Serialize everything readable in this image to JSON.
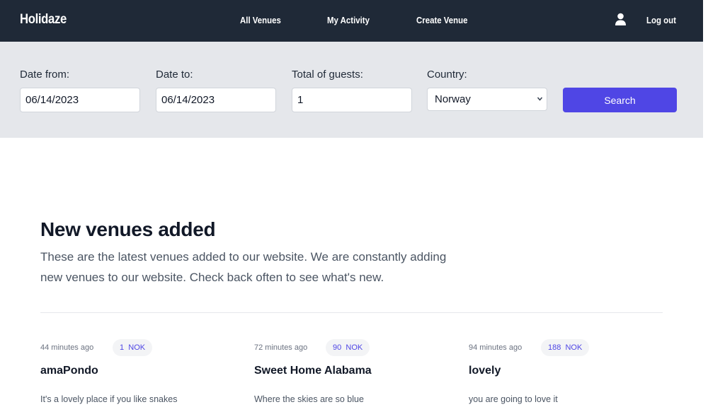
{
  "header": {
    "brand": "Holidaze",
    "nav": {
      "all_venues": "All Venues",
      "my_activity": "My Activity",
      "create_venue": "Create Venue"
    },
    "logout": "Log out",
    "icons": {
      "user": "user-icon"
    }
  },
  "search": {
    "date_from_label": "Date from:",
    "date_from_value": "06/14/2023",
    "date_to_label": "Date to:",
    "date_to_value": "06/14/2023",
    "guests_label": "Total of guests:",
    "guests_value": "1",
    "country_label": "Country:",
    "country_value": "Norway",
    "button": "Search"
  },
  "main": {
    "title": "New venues added",
    "description": "These are the latest venues added to our website. We are constantly adding new venues to our website. Check back often to see what's new."
  },
  "venues": [
    {
      "time": "44 minutes ago",
      "price": "1",
      "currency": "NOK",
      "title": "amaPondo",
      "description": "It's a lovely place if you like snakes"
    },
    {
      "time": "72 minutes ago",
      "price": "90",
      "currency": "NOK",
      "title": "Sweet Home Alabama",
      "description": "Where the skies are so blue"
    },
    {
      "time": "94 minutes ago",
      "price": "188",
      "currency": "NOK",
      "title": "lovely",
      "description": "you are going to love it"
    }
  ],
  "colors": {
    "header_bg": "#1f2937",
    "search_bg": "#e5e7eb",
    "accent": "#4f46e5"
  }
}
